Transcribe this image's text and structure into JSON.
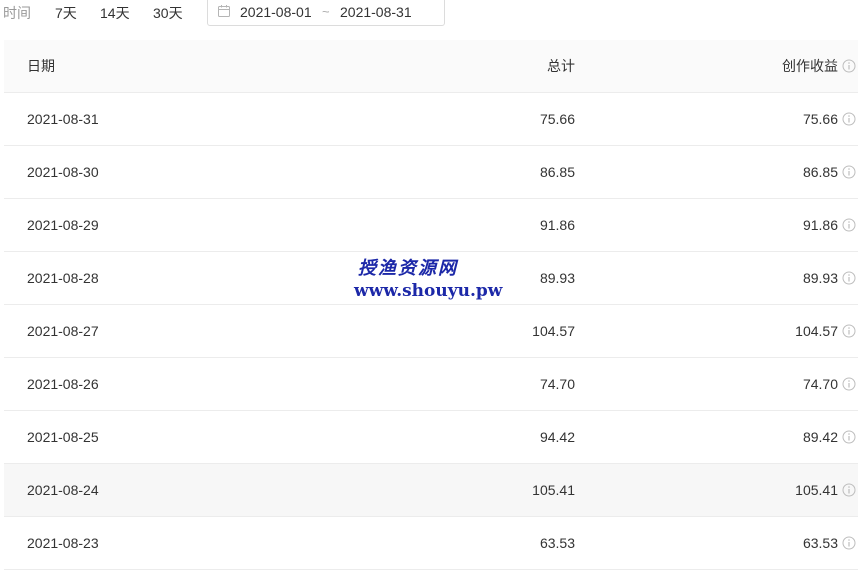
{
  "filter": {
    "label": "时间",
    "ranges": [
      "7天",
      "14天",
      "30天"
    ],
    "date_start": "2021-08-01",
    "date_separator": "~",
    "date_end": "2021-08-31"
  },
  "table": {
    "headers": {
      "date": "日期",
      "total": "总计",
      "income": "创作收益"
    },
    "rows": [
      {
        "date": "2021-08-31",
        "total": "75.66",
        "income": "75.66"
      },
      {
        "date": "2021-08-30",
        "total": "86.85",
        "income": "86.85"
      },
      {
        "date": "2021-08-29",
        "total": "91.86",
        "income": "91.86"
      },
      {
        "date": "2021-08-28",
        "total": "89.93",
        "income": "89.93"
      },
      {
        "date": "2021-08-27",
        "total": "104.57",
        "income": "104.57"
      },
      {
        "date": "2021-08-26",
        "total": "74.70",
        "income": "74.70"
      },
      {
        "date": "2021-08-25",
        "total": "94.42",
        "income": "89.42"
      },
      {
        "date": "2021-08-24",
        "total": "105.41",
        "income": "105.41"
      },
      {
        "date": "2021-08-23",
        "total": "63.53",
        "income": "63.53"
      }
    ]
  },
  "watermark": {
    "line1": "授渔资源网",
    "line2": "www.shouyu.pw"
  },
  "icons": {
    "calendar": "calendar-icon",
    "info": "info-icon"
  },
  "colors": {
    "watermark": "#1c28a8",
    "muted_text": "#999999",
    "header_bg": "#fafafa",
    "highlight_row_bg": "#f7f7f7"
  }
}
